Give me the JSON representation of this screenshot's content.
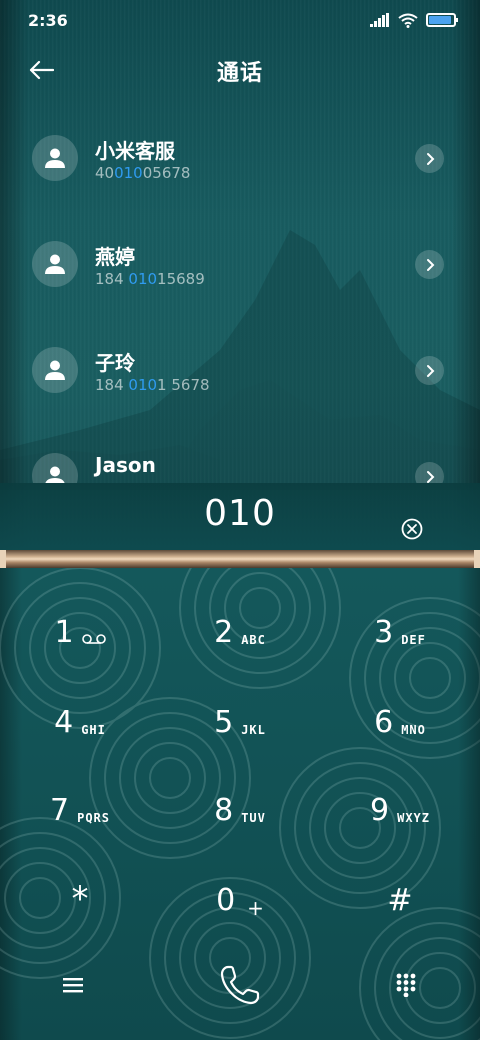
{
  "status_bar": {
    "time": "2:36",
    "signal_icon": "signal-bars-icon",
    "wifi_icon": "wifi-icon",
    "battery_icon": "battery-icon",
    "battery_level": 0.9,
    "accent_color": "#4ba3f0"
  },
  "header": {
    "title": "通话",
    "back_icon": "arrow-left-icon"
  },
  "contacts": [
    {
      "name": "小米客服",
      "number_pre": "40",
      "number_match": "010",
      "number_post": "05678"
    },
    {
      "name": "燕婷",
      "number_pre": "184 ",
      "number_match": "010",
      "number_post": "15689"
    },
    {
      "name": "子玲",
      "number_pre": "184 ",
      "number_match": "010",
      "number_post": "1 5678"
    },
    {
      "name": "Jason",
      "number_pre": "",
      "number_match": "",
      "number_post": ""
    }
  ],
  "dial": {
    "input_value": "010",
    "clear_icon": "clear-circle-x-icon",
    "highlight_color": "#2f9bf0"
  },
  "keypad": {
    "k1": {
      "digit": "1",
      "letters": ""
    },
    "k2": {
      "digit": "2",
      "letters": "ABC"
    },
    "k3": {
      "digit": "3",
      "letters": "DEF"
    },
    "k4": {
      "digit": "4",
      "letters": "GHI"
    },
    "k5": {
      "digit": "5",
      "letters": "JKL"
    },
    "k6": {
      "digit": "6",
      "letters": "MNO"
    },
    "k7": {
      "digit": "7",
      "letters": "PQRS"
    },
    "k8": {
      "digit": "8",
      "letters": "TUV"
    },
    "k9": {
      "digit": "9",
      "letters": "WXYZ"
    },
    "kstar": {
      "digit": "*"
    },
    "k0": {
      "digit": "0",
      "letters": "+"
    },
    "khash": {
      "digit": "#"
    }
  },
  "bottom_bar": {
    "menu_icon": "menu-icon",
    "call_icon": "phone-call-icon",
    "dialpad_icon": "dialpad-grid-icon"
  }
}
